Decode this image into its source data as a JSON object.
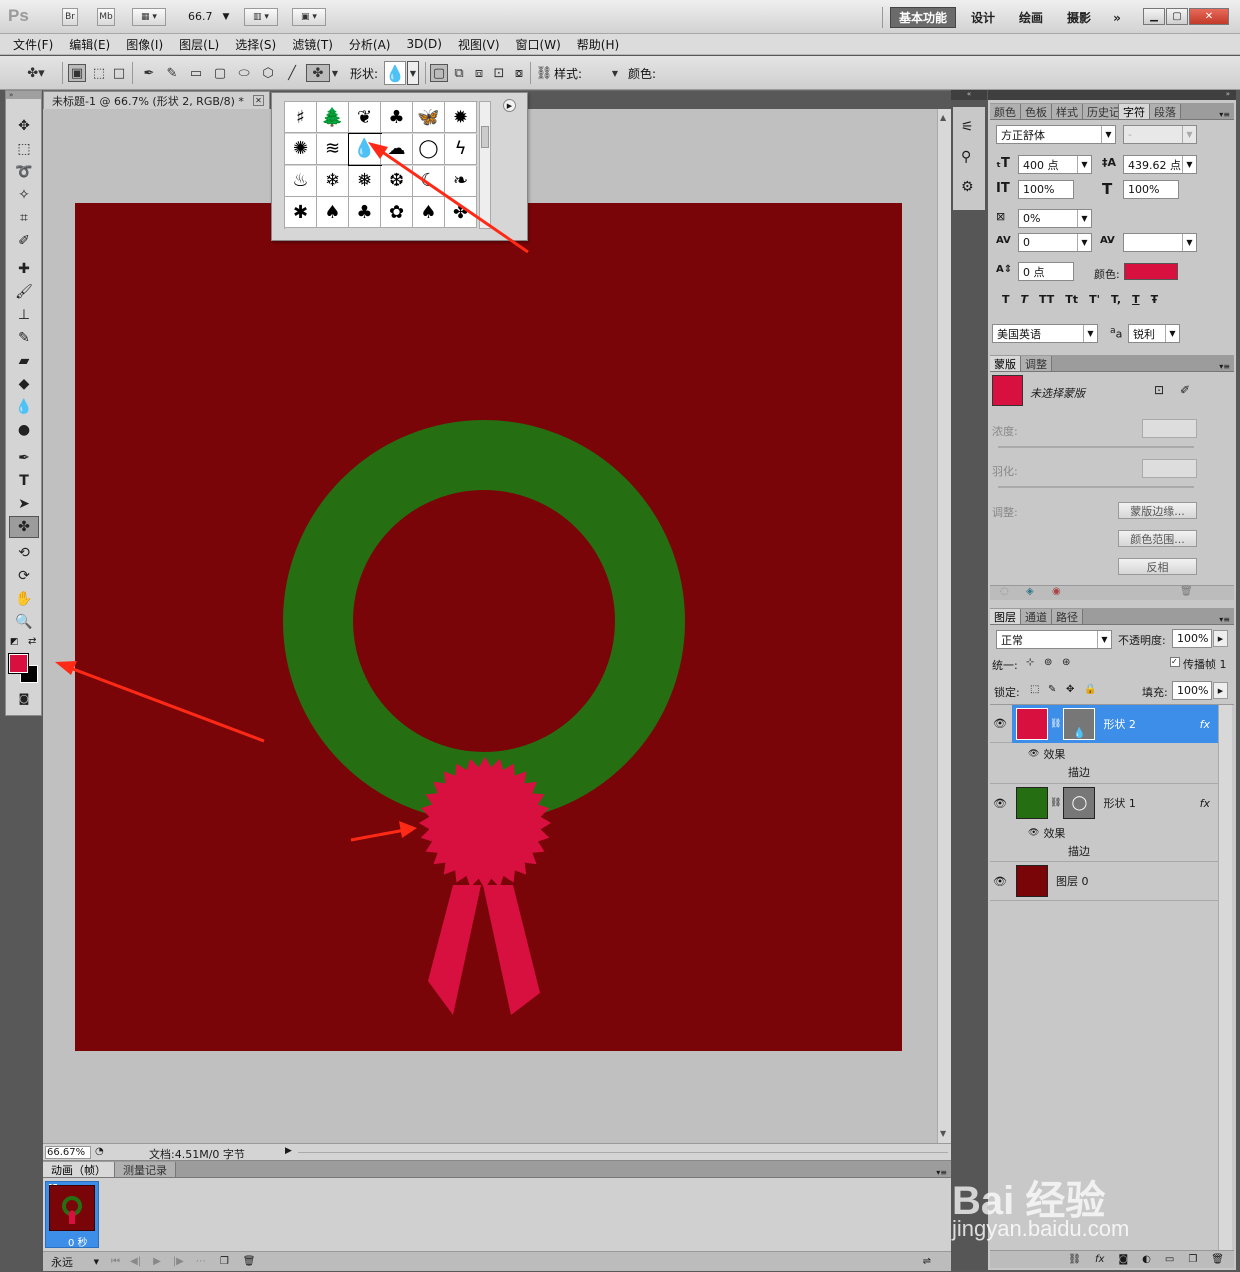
{
  "app": {
    "logo": "Ps",
    "br": "Br",
    "mb": "Mb",
    "zoom_combo": "66.7"
  },
  "workspaces": [
    {
      "label": "基本功能"
    },
    {
      "label": "设计"
    },
    {
      "label": "绘画"
    },
    {
      "label": "摄影"
    }
  ],
  "menu": [
    "文件(F)",
    "编辑(E)",
    "图像(I)",
    "图层(L)",
    "选择(S)",
    "滤镜(T)",
    "分析(A)",
    "3D(D)",
    "视图(V)",
    "窗口(W)",
    "帮助(H)"
  ],
  "options": {
    "shape_label": "形状:",
    "style_label": "样式:",
    "color_label": "颜色:",
    "color_value": "#d8103f"
  },
  "document": {
    "tab_title": "未标题-1 @ 66.7% (形状 2, RGB/8) *",
    "zoom": "66.67%",
    "doc_info": "文档:4.51M/0 字节"
  },
  "canvas": {
    "background": "#7a0508",
    "wreath_color": "#256f12",
    "badge_color": "#d8103f"
  },
  "colors": {
    "foreground": "#d8103f",
    "background": "#000000"
  },
  "shape_picker": {
    "shapes": [
      {
        "glyph": "♯",
        "name": "grid-shape-icon"
      },
      {
        "glyph": "🌲",
        "name": "tree-shape-icon"
      },
      {
        "glyph": "❦",
        "name": "fern-shape-icon"
      },
      {
        "glyph": "♣",
        "name": "clover-shape-icon"
      },
      {
        "glyph": "🦋",
        "name": "butterfly-shape-icon"
      },
      {
        "glyph": "✹",
        "name": "sun-burst-shape-icon"
      },
      {
        "glyph": "✺",
        "name": "sun-shape-icon"
      },
      {
        "glyph": "≋",
        "name": "waves-shape-icon"
      },
      {
        "glyph": "💧",
        "name": "raindrop-shape-icon"
      },
      {
        "glyph": "☁",
        "name": "cloud-shape-icon"
      },
      {
        "glyph": "◯",
        "name": "cloud-outline-shape-icon"
      },
      {
        "glyph": "ϟ",
        "name": "lightning-shape-icon"
      },
      {
        "glyph": "♨",
        "name": "fire-shape-icon"
      },
      {
        "glyph": "❄",
        "name": "snowflake1-shape-icon"
      },
      {
        "glyph": "❅",
        "name": "snowflake2-shape-icon"
      },
      {
        "glyph": "❆",
        "name": "snowflake3-shape-icon"
      },
      {
        "glyph": "☾",
        "name": "moon-shape-icon"
      },
      {
        "glyph": "❧",
        "name": "leaf-shape-icon"
      },
      {
        "glyph": "✱",
        "name": "leaf-maple-shape-icon"
      },
      {
        "glyph": "♠",
        "name": "leaf-shape-icon-2"
      },
      {
        "glyph": "♣",
        "name": "leaf-shape-icon-3"
      },
      {
        "glyph": "✿",
        "name": "maple-leaf-shape-icon"
      },
      {
        "glyph": "♠",
        "name": "leaf-shape-icon-4"
      },
      {
        "glyph": "✤",
        "name": "leaf-shape-icon-5"
      }
    ]
  },
  "character_panel": {
    "tabs": [
      "颜色",
      "色板",
      "样式",
      "历史记录",
      "字符",
      "段落"
    ],
    "font_family": "方正舒体",
    "font_style": "-",
    "font_size": "400 点",
    "leading": "439.62 点",
    "vscale": "100%",
    "hscale": "100%",
    "tracking_pct": "0%",
    "kerning": "0",
    "baseline": "0 点",
    "color_label": "颜色:",
    "color_value": "#d8103f",
    "language": "美国英语",
    "aa_label": "a",
    "antialias": "锐利",
    "styles": [
      "T",
      "T",
      "TT",
      "Tt",
      "T'",
      "T,",
      "T",
      "Ŧ"
    ]
  },
  "mask_panel": {
    "tabs": [
      "蒙版",
      "调整"
    ],
    "title": "未选择蒙版",
    "density_label": "浓度:",
    "feather_label": "羽化:",
    "adjust_label": "调整:",
    "mask_edge": "蒙版边缘...",
    "color_range": "颜色范围...",
    "invert": "反相"
  },
  "layers_panel": {
    "tabs": [
      "图层",
      "通道",
      "路径"
    ],
    "blend_mode": "正常",
    "opacity_label": "不透明度:",
    "opacity": "100%",
    "unify_label": "统一:",
    "propagate_label": "传播帧 1",
    "lock_label": "锁定:",
    "fill_label": "填充:",
    "fill": "100%",
    "layers": [
      {
        "name": "形状 2",
        "color": "#d8103f",
        "selected": true,
        "effects_label": "效果",
        "stroke_label": "描边"
      },
      {
        "name": "形状 1",
        "color": "#256f12",
        "selected": false,
        "effects_label": "效果",
        "stroke_label": "描边"
      },
      {
        "name": "图层 0",
        "color": "#7a0508",
        "selected": false
      }
    ]
  },
  "animation": {
    "tabs": [
      "动画（帧）",
      "测量记录"
    ],
    "frame_number": "1",
    "frame_time": "0 秒",
    "loop": "永远"
  },
  "watermark": {
    "brand": "Bai 经验",
    "url": "jingyan.baidu.com"
  }
}
